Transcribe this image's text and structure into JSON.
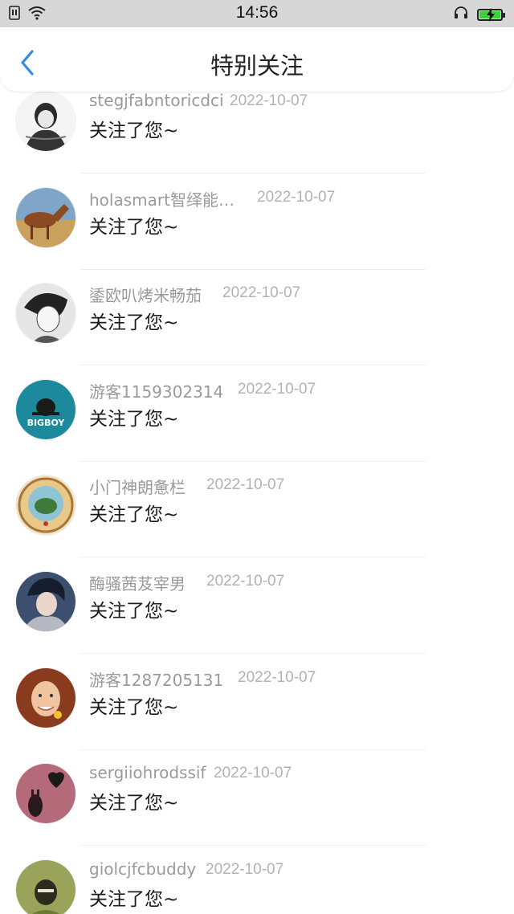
{
  "status_bar": {
    "time": "14:56",
    "icons": [
      "sim-icon",
      "wifi-icon",
      "headset-icon",
      "battery-charging-icon"
    ],
    "battery_color": "#3bd13b"
  },
  "header": {
    "title": "特别关注",
    "back_icon": "chevron-left-icon",
    "accent_color": "#2b8fe8"
  },
  "items": [
    {
      "name": "stegjfabntoricdci",
      "date": "2022-10-07",
      "message": "关注了您~"
    },
    {
      "name": "holasmart智绎能…",
      "date": "2022-10-07",
      "message": "关注了您~"
    },
    {
      "name": "鋈欧叭烤米畅茄",
      "date": "2022-10-07",
      "message": "关注了您~"
    },
    {
      "name": "游客1159302314",
      "date": "2022-10-07",
      "message": "关注了您~"
    },
    {
      "name": "小门神朗惫栏",
      "date": "2022-10-07",
      "message": "关注了您~"
    },
    {
      "name": "酶骚茜芨宰男",
      "date": "2022-10-07",
      "message": "关注了您~"
    },
    {
      "name": "游客1287205131",
      "date": "2022-10-07",
      "message": "关注了您~"
    },
    {
      "name": "sergiiohrodssif",
      "date": "2022-10-07",
      "message": "关注了您~"
    },
    {
      "name": "giolcjfcbuddy",
      "date": "2022-10-07",
      "message": "关注了您~"
    }
  ]
}
